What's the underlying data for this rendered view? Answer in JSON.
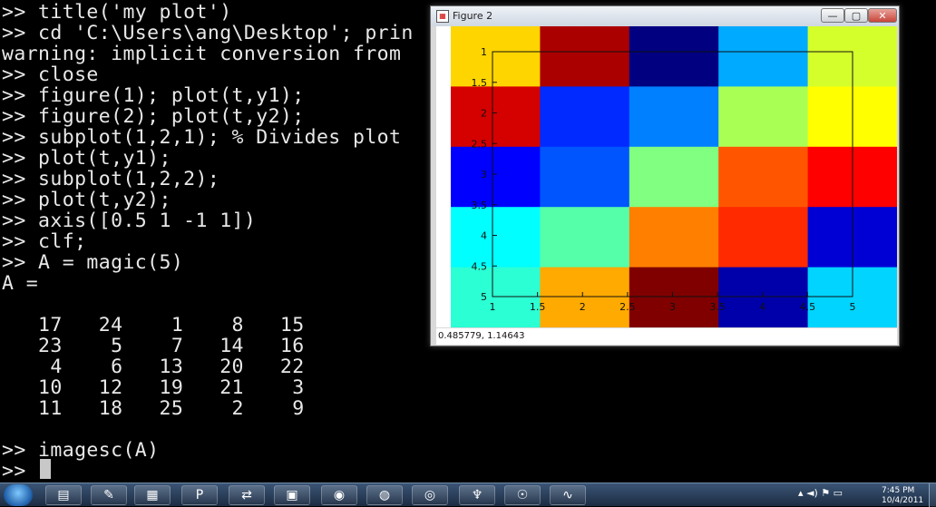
{
  "terminal": {
    "lines": [
      ">> title('my plot')",
      ">> cd 'C:\\Users\\ang\\Desktop'; prin",
      "warning: implicit conversion from",
      ">> close",
      ">> figure(1); plot(t,y1);",
      ">> figure(2); plot(t,y2);",
      ">> subplot(1,2,1); % Divides plot",
      ">> plot(t,y1);",
      ">> subplot(1,2,2);",
      ">> plot(t,y2);",
      ">> axis([0.5 1 -1 1])",
      ">> clf;",
      ">> A = magic(5)",
      "A =",
      "",
      "   17   24    1    8   15",
      "   23    5    7   14   16",
      "    4    6   13   20   22",
      "   10   12   19   21    3",
      "   11   18   25    2    9",
      "",
      ">> imagesc(A)",
      ">> "
    ],
    "text_color": "#e8e8e8",
    "background": "#000000"
  },
  "figure_window": {
    "title": "Figure 2",
    "minimize_label": "—",
    "maximize_label": "▢",
    "close_label": "✕",
    "status_text": "0.485779, 1.14643"
  },
  "chart_data": {
    "type": "heatmap",
    "matrix": [
      [
        17,
        24,
        1,
        8,
        15
      ],
      [
        23,
        5,
        7,
        14,
        16
      ],
      [
        4,
        6,
        13,
        20,
        22
      ],
      [
        10,
        12,
        19,
        21,
        3
      ],
      [
        11,
        18,
        25,
        2,
        9
      ]
    ],
    "colormap": "jet",
    "clim": [
      1,
      25
    ],
    "xlim": [
      0.5,
      5.5
    ],
    "ylim": [
      0.5,
      5.5
    ],
    "y_reversed": true,
    "x_ticks": [
      "1",
      "1.5",
      "2",
      "2.5",
      "3",
      "3.5",
      "4",
      "4.5",
      "5"
    ],
    "y_ticks": [
      "1",
      "1.5",
      "2",
      "2.5",
      "3",
      "3.5",
      "4",
      "4.5",
      "5"
    ],
    "axes_box_x": [
      0.5,
      5.5
    ],
    "axes_box_y": [
      0.5,
      5.5
    ]
  },
  "taskbar": {
    "apps": [
      {
        "icon": "explorer-icon",
        "glyph": "▤"
      },
      {
        "icon": "notes-icon",
        "glyph": "✎"
      },
      {
        "icon": "film-icon",
        "glyph": "▦"
      },
      {
        "icon": "powerpoint-icon",
        "glyph": "P"
      },
      {
        "icon": "network-icon",
        "glyph": "⇄"
      },
      {
        "icon": "remote-desktop-icon",
        "glyph": "▣"
      },
      {
        "icon": "camera-icon",
        "glyph": "◉"
      },
      {
        "icon": "chrome-icon",
        "glyph": "◍"
      },
      {
        "icon": "recorder-icon",
        "glyph": "◎"
      },
      {
        "icon": "python-icon",
        "glyph": "♆"
      },
      {
        "icon": "skype-icon",
        "glyph": "☉"
      },
      {
        "icon": "octave-plot-icon",
        "glyph": "∿"
      }
    ],
    "tray_glyphs": "▴ ◄) ⚑ ▭",
    "clock_time": "7:45 PM",
    "clock_date": "10/4/2011"
  }
}
